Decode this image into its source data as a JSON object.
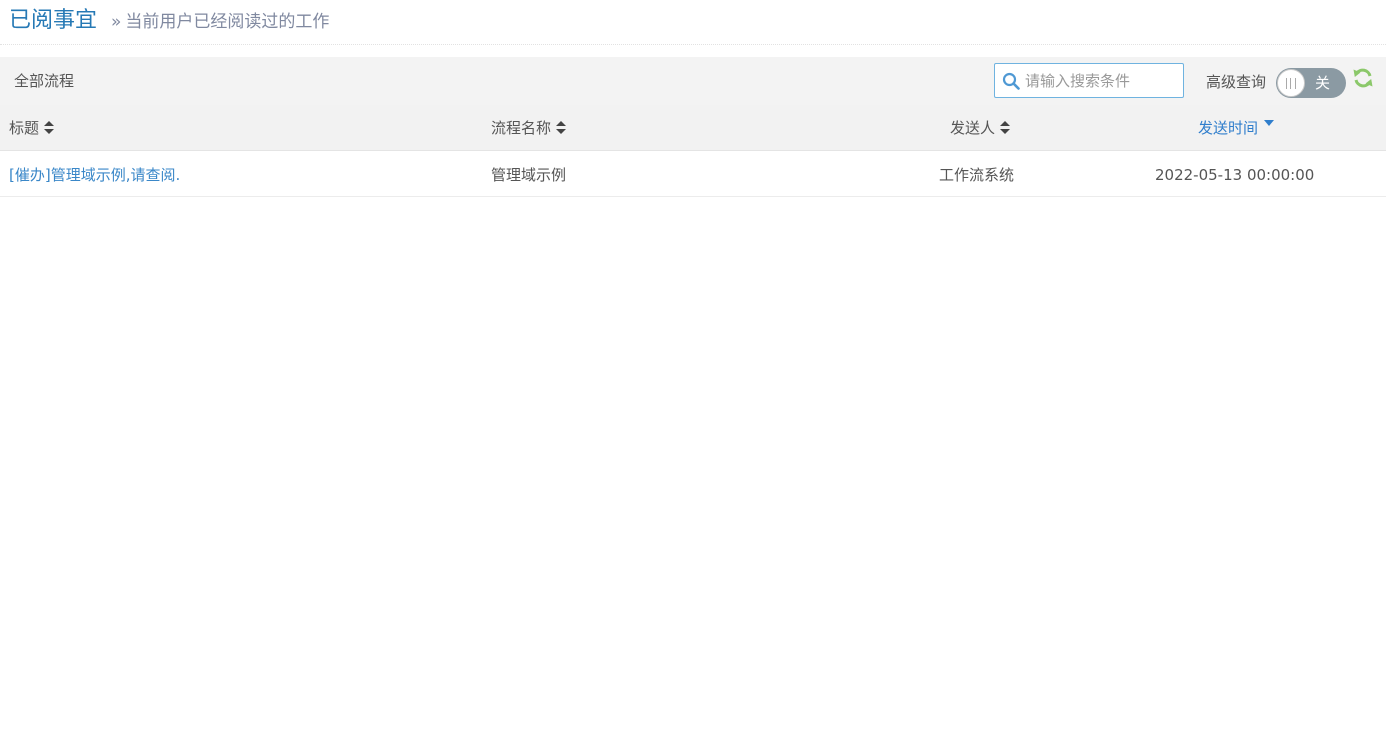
{
  "header": {
    "title": "已阅事宜",
    "separator": "»",
    "subtitle": "当前用户已经阅读过的工作"
  },
  "toolbar": {
    "title": "全部流程",
    "search": {
      "placeholder": "请输入搜索条件",
      "value": ""
    },
    "advanced_label": "高级查询",
    "toggle": {
      "state": "关",
      "on": false
    }
  },
  "table": {
    "columns": [
      {
        "label": "标题",
        "sort": "none"
      },
      {
        "label": "流程名称",
        "sort": "none"
      },
      {
        "label": "发送人",
        "sort": "none"
      },
      {
        "label": "发送时间",
        "sort": "desc"
      }
    ],
    "rows": [
      {
        "title": "[催办]管理域示例,请查阅.",
        "process_name": "管理域示例",
        "sender": "工作流系统",
        "send_time": "2022-05-13 00:00:00"
      }
    ]
  },
  "icons": {
    "search": "search-icon",
    "refresh": "refresh-icon",
    "sort": "sort-icon",
    "sort_desc": "sort-desc-icon"
  },
  "colors": {
    "accent": "#2679b5",
    "link": "#3a87c8",
    "refresh": "#8bc86a",
    "toggle_off": "#8b9aa3",
    "search_border": "#6fb3e0"
  }
}
